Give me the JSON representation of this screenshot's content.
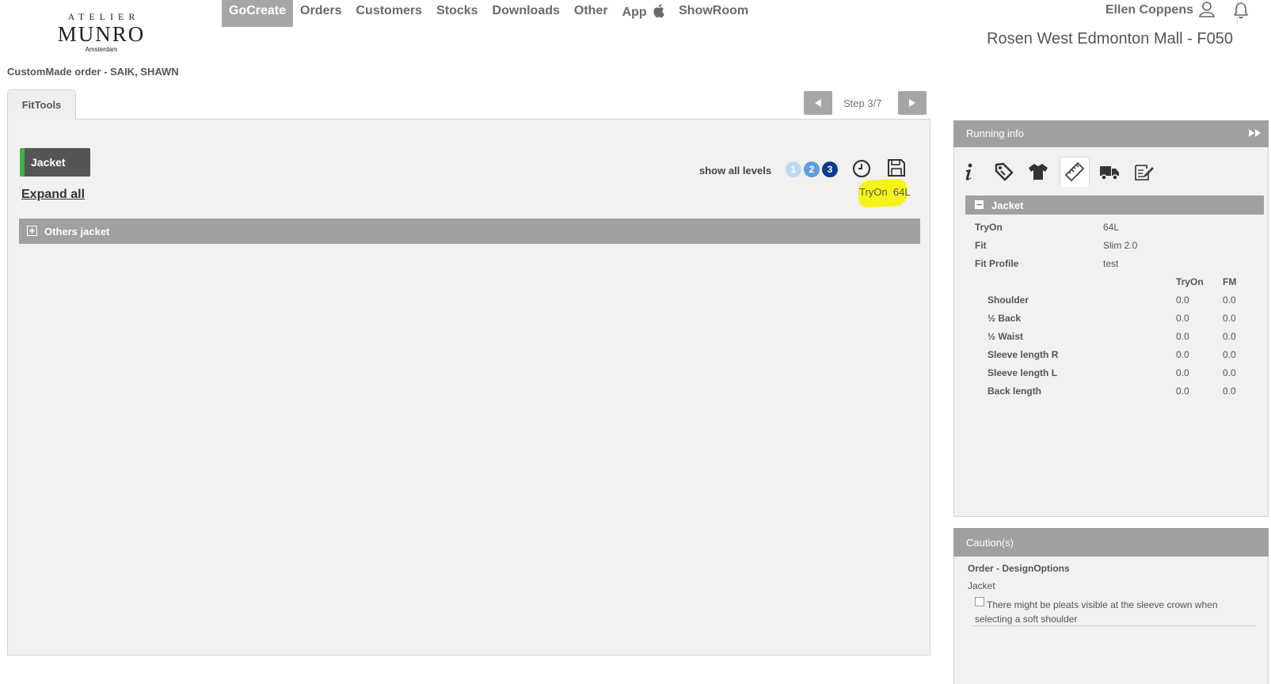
{
  "logo": {
    "line1": "ATELIER",
    "line2": "MUNRO",
    "line3": "Amsterdam"
  },
  "nav": {
    "items": [
      "GoCreate",
      "Orders",
      "Customers",
      "Stocks",
      "Downloads",
      "Other",
      "App",
      "ShowRoom"
    ],
    "active": "GoCreate"
  },
  "user": {
    "name": "Ellen Coppens",
    "store": "Rosen West Edmonton Mall - F050"
  },
  "order": {
    "title": "CustomMade order - SAIK, SHAWN"
  },
  "tab": {
    "label": "FitTools"
  },
  "step": {
    "label": "Step 3/7"
  },
  "main": {
    "jacket_label": "Jacket",
    "expand_all": "Expand all",
    "show_levels": "show all levels",
    "levels": [
      "1",
      "2",
      "3"
    ],
    "tryon_label": "TryOn",
    "tryon_value": "64L",
    "others_label": "Others jacket"
  },
  "running_info": {
    "title": "Running info",
    "tab_icons": [
      "info-icon",
      "tag-icon",
      "shirt-icon",
      "ruler-icon",
      "truck-icon",
      "note-icon"
    ],
    "active_tab": "ruler-icon",
    "section": "Jacket",
    "fields": [
      {
        "label": "TryOn",
        "value": "64L"
      },
      {
        "label": "Fit",
        "value": "Slim 2.0"
      },
      {
        "label": "Fit Profile",
        "value": "test"
      }
    ],
    "columns": [
      "TryOn",
      "FM"
    ],
    "rows": [
      {
        "label": "Shoulder",
        "tryon": "0.0",
        "fm": "0.0"
      },
      {
        "label": "½ Back",
        "tryon": "0.0",
        "fm": "0.0"
      },
      {
        "label": "½ Waist",
        "tryon": "0.0",
        "fm": "0.0"
      },
      {
        "label": "Sleeve length R",
        "tryon": "0.0",
        "fm": "0.0"
      },
      {
        "label": "Sleeve length L",
        "tryon": "0.0",
        "fm": "0.0"
      },
      {
        "label": "Back length",
        "tryon": "0.0",
        "fm": "0.0"
      }
    ]
  },
  "caution": {
    "title": "Caution(s)",
    "category": "Order - DesignOptions",
    "item": "Jacket",
    "message_line1": "There might be pleats visible at the sleeve crown when",
    "message_line2": "selecting a soft shoulder"
  },
  "colors": {
    "accent_green": "#3cb340",
    "highlight": "#f4f41a",
    "bar_gray": "#a0a0a0"
  }
}
